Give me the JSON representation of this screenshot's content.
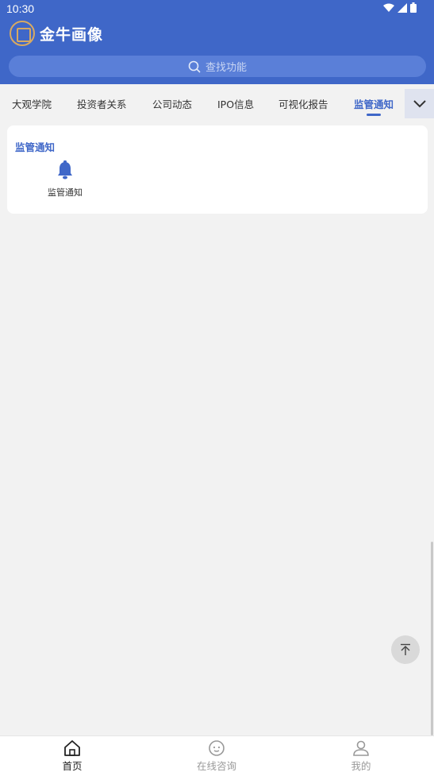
{
  "status": {
    "time": "10:30"
  },
  "brand": {
    "name": "金牛画像"
  },
  "search": {
    "placeholder": "查找功能"
  },
  "tabs": [
    {
      "label": "大观学院"
    },
    {
      "label": "投资者关系"
    },
    {
      "label": "公司动态"
    },
    {
      "label": "IPO信息"
    },
    {
      "label": "可视化报告"
    },
    {
      "label": "监管通知"
    }
  ],
  "active_tab": "监管通知",
  "section": {
    "title": "监管通知",
    "items": [
      {
        "label": "监管通知",
        "icon": "bell-icon"
      }
    ]
  },
  "bottom_nav": [
    {
      "label": "首页",
      "icon": "home-icon"
    },
    {
      "label": "在线咨询",
      "icon": "chat-icon"
    },
    {
      "label": "我的",
      "icon": "user-icon"
    }
  ],
  "colors": {
    "primary": "#3f67c8",
    "background": "#f2f2f2",
    "logo_gold": "#d7a962"
  }
}
